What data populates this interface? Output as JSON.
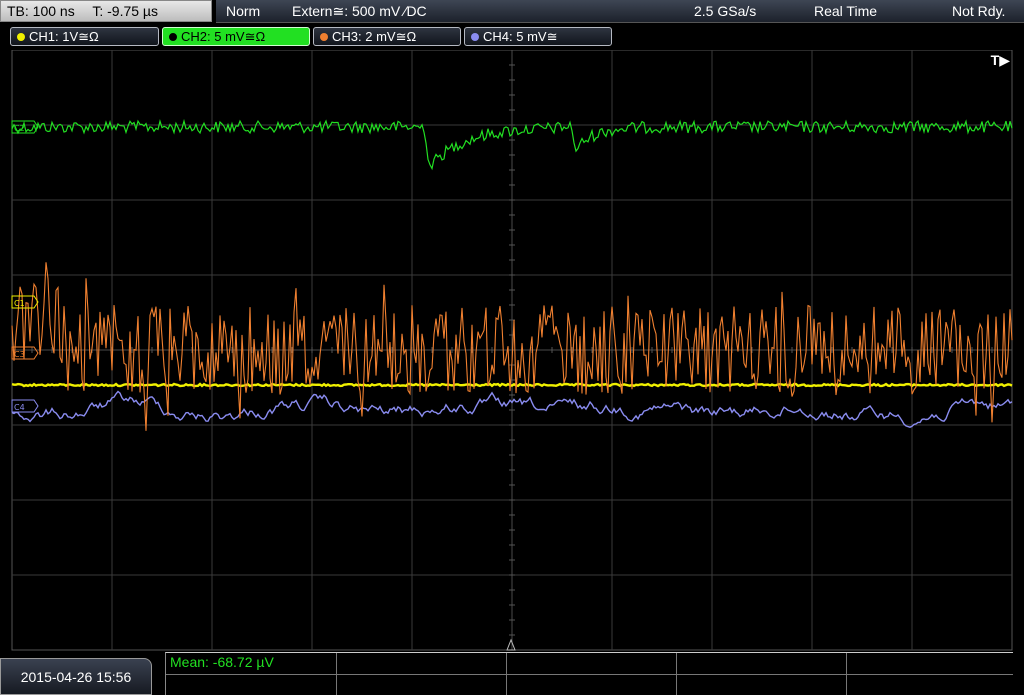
{
  "topbar": {
    "timebase": "TB: 100 ns",
    "trigger_time": "T: -9.75 µs",
    "mode": "Norm",
    "trigger_source": "Extern≅: 500 mV ∕DC",
    "sample_rate": "2.5 GSa/s",
    "acquisition": "Real Time",
    "ready_state": "Not Rdy."
  },
  "channels": [
    {
      "label": "CH1: 1V≅Ω",
      "color": "#f0f000"
    },
    {
      "label": "CH2: 5 mV≅Ω",
      "color": "#22e022",
      "active": true
    },
    {
      "label": "CH3: 2 mV≅Ω",
      "color": "#f08030"
    },
    {
      "label": "CH4: 5 mV≅",
      "color": "#8a8cf0"
    }
  ],
  "trigger_indicator": "T▶",
  "markers": {
    "ch1": "C1",
    "ch2": "C2",
    "ch3": "C3",
    "ch4": "C4"
  },
  "datetime": "2015-04-26 15:56",
  "measurement": {
    "mean": "Mean: -68.72 µV"
  },
  "colors": {
    "grid": "#3a3a3a",
    "ch1": "#f0f000",
    "ch2": "#22e022",
    "ch3": "#f08030",
    "ch4": "#8a8cf0"
  }
}
